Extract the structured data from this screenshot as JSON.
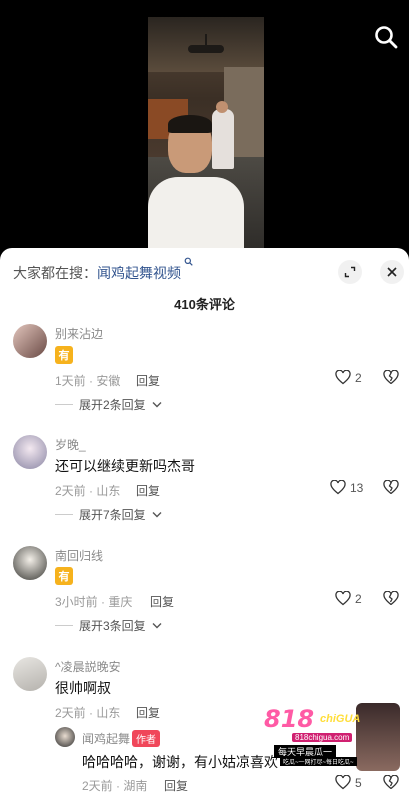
{
  "search_hint": {
    "prefix": "大家都在搜：",
    "keyword": "闻鸡起舞视频",
    "suffix_icon": "search-mini-icon"
  },
  "comments_count": "410条评论",
  "comments": [
    {
      "username": "别来沾边",
      "text_badge": "有",
      "meta": "1天前 · 安徽",
      "reply_label": "回复",
      "likes": "2",
      "expand_label": "展开2条回复"
    },
    {
      "username": "岁晚_",
      "text": "还可以继续更新吗杰哥",
      "meta": "2天前 · 山东",
      "reply_label": "回复",
      "likes": "13",
      "expand_label": "展开7条回复"
    },
    {
      "username": "南回归线",
      "text_badge": "有",
      "meta": "3小时前 · 重庆",
      "reply_label": "回复",
      "likes": "2",
      "expand_label": "展开3条回复"
    },
    {
      "username": "^凌晨説晚安",
      "text": "很帅啊叔",
      "meta": "2天前 · 山东",
      "reply_label": "回复",
      "reply": {
        "username": "闻鸡起舞",
        "author_tag": "作者",
        "text": "哈哈哈哈，谢谢，有小姑凉喜欢",
        "meta": "2天前 · 湖南",
        "reply_label": "回复",
        "likes": "5"
      }
    }
  ],
  "watermark": {
    "logo": "818",
    "logo_sub": "chiGUA",
    "url": "818chigua.com",
    "slogan": "每天早晨瓜一",
    "sub": "吃瓜~一网打尽~每日吃瓜~"
  },
  "icons": {
    "search": "search-icon",
    "expand": "expand-icon",
    "close": "close-icon",
    "like": "heart-icon",
    "dislike": "broken-heart-icon",
    "chevron": "chevron-down-icon"
  }
}
